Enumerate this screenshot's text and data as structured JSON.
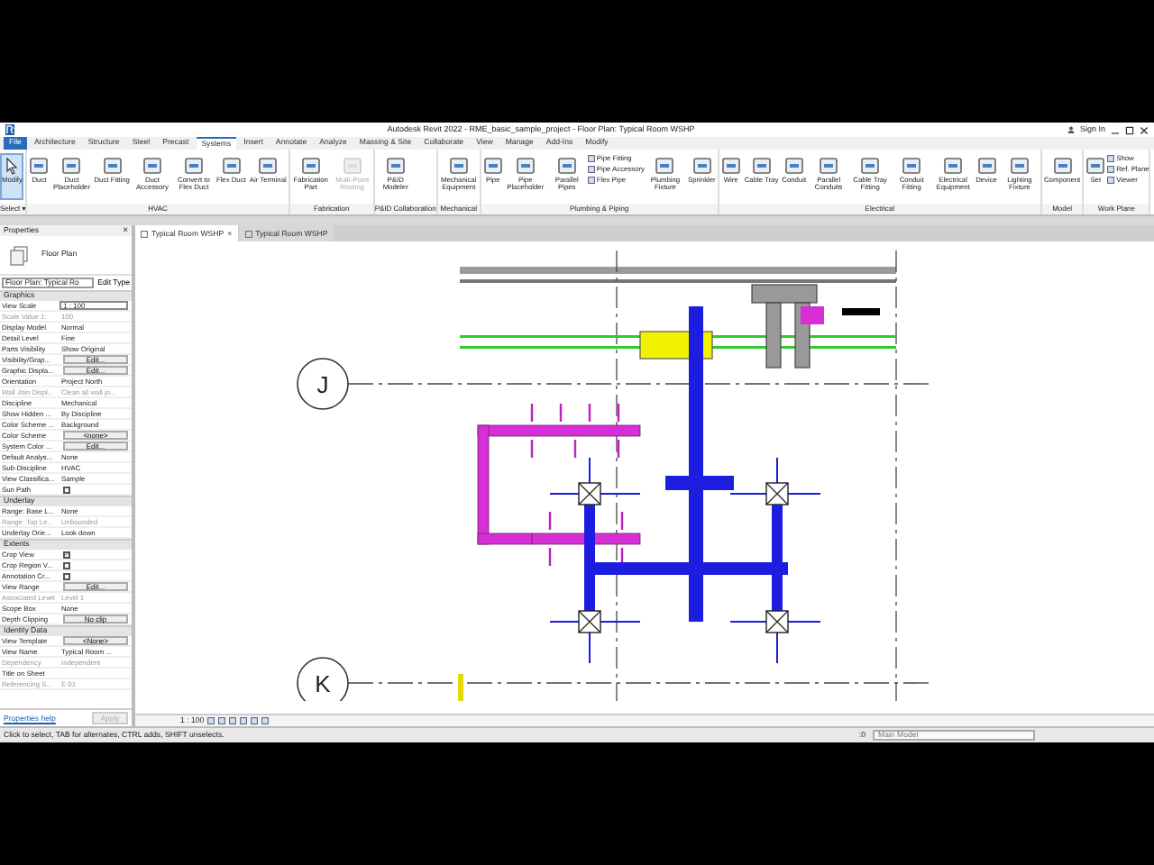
{
  "title_bar": {
    "title": "Autodesk Revit 2022 - RME_basic_sample_project - Floor Plan: Typical Room WSHP",
    "sign_in": "Sign In"
  },
  "menu_tabs": [
    {
      "label": "File",
      "selected": false
    },
    {
      "label": "Architecture",
      "selected": false
    },
    {
      "label": "Structure",
      "selected": false
    },
    {
      "label": "Steel",
      "selected": false
    },
    {
      "label": "Precast",
      "selected": false
    },
    {
      "label": "Systems",
      "selected": true
    },
    {
      "label": "Insert",
      "selected": false
    },
    {
      "label": "Annotate",
      "selected": false
    },
    {
      "label": "Analyze",
      "selected": false
    },
    {
      "label": "Massing & Site",
      "selected": false
    },
    {
      "label": "Collaborate",
      "selected": false
    },
    {
      "label": "View",
      "selected": false
    },
    {
      "label": "Manage",
      "selected": false
    },
    {
      "label": "Add-Ins",
      "selected": false
    },
    {
      "label": "Modify",
      "selected": false
    }
  ],
  "ribbon": {
    "modify_button": {
      "label": "Modify",
      "selected": true,
      "footer": "Select ▾"
    },
    "groups": [
      {
        "label": "HVAC",
        "tools": [
          {
            "kind": "large",
            "label": "Duct",
            "disabled": false
          },
          {
            "kind": "large",
            "label": "Duct Placeholder",
            "disabled": false
          },
          {
            "kind": "large",
            "label": "Duct Fitting",
            "disabled": false
          },
          {
            "kind": "large",
            "label": "Duct Accessory",
            "disabled": false
          },
          {
            "kind": "large",
            "label": "Convert to Flex Duct",
            "disabled": false
          },
          {
            "kind": "large",
            "label": "Flex Duct",
            "disabled": false
          },
          {
            "kind": "large",
            "label": "Air Terminal",
            "disabled": false
          }
        ]
      },
      {
        "label": "Fabrication",
        "tools": [
          {
            "kind": "large",
            "label": "Fabrication Part",
            "disabled": false
          },
          {
            "kind": "large",
            "label": "Multi-Point Routing",
            "disabled": true
          }
        ]
      },
      {
        "label": "P&ID Collaboration",
        "tools": [
          {
            "kind": "large",
            "label": "P&ID Modeler",
            "disabled": false
          }
        ]
      },
      {
        "label": "Mechanical",
        "tools": [
          {
            "kind": "large",
            "label": "Mechanical Equipment",
            "disabled": false
          }
        ]
      },
      {
        "label": "Plumbing & Piping",
        "tools": [
          {
            "kind": "large",
            "label": "Pipe",
            "disabled": false
          },
          {
            "kind": "large",
            "label": "Pipe Placeholder",
            "disabled": false
          },
          {
            "kind": "large",
            "label": "Parallel Pipes",
            "disabled": false
          },
          {
            "kind": "stack",
            "items": [
              {
                "label": "Pipe Fitting",
                "disabled": false
              },
              {
                "label": "Pipe Accessory",
                "disabled": false
              },
              {
                "label": "Flex Pipe",
                "disabled": false
              }
            ]
          },
          {
            "kind": "large",
            "label": "Plumbing Fixture",
            "disabled": false
          },
          {
            "kind": "large",
            "label": "Sprinkler",
            "disabled": false
          }
        ]
      },
      {
        "label": "Electrical",
        "tools": [
          {
            "kind": "large",
            "label": "Wire",
            "disabled": false
          },
          {
            "kind": "large",
            "label": "Cable Tray",
            "disabled": false
          },
          {
            "kind": "large",
            "label": "Conduit",
            "disabled": false
          },
          {
            "kind": "large",
            "label": "Parallel Conduits",
            "disabled": false
          },
          {
            "kind": "large",
            "label": "Cable Tray Fitting",
            "disabled": false
          },
          {
            "kind": "large",
            "label": "Conduit Fitting",
            "disabled": false
          },
          {
            "kind": "large",
            "label": "Electrical Equipment",
            "disabled": false
          },
          {
            "kind": "large",
            "label": "Device",
            "disabled": false
          },
          {
            "kind": "large",
            "label": "Lighting Fixture",
            "disabled": false
          }
        ]
      },
      {
        "label": "Model",
        "tools": [
          {
            "kind": "large",
            "label": "Component",
            "disabled": false
          }
        ]
      },
      {
        "label": "Work Plane",
        "tools": [
          {
            "kind": "large",
            "label": "Set",
            "disabled": false
          },
          {
            "kind": "stack",
            "items": [
              {
                "label": "Show",
                "disabled": false
              },
              {
                "label": "Ref. Plane",
                "disabled": false
              },
              {
                "label": "Viewer",
                "disabled": false
              }
            ]
          }
        ]
      }
    ]
  },
  "properties": {
    "title": "Properties",
    "close": "×",
    "type_name": "Floor Plan",
    "type_selector": "Floor Plan: Typical Ro",
    "edit_type": "Edit Type",
    "sections": [
      {
        "title": "Graphics",
        "rows": [
          {
            "kind": "field",
            "label": "View Scale",
            "value": "1 : 100",
            "disabled": false
          },
          {
            "kind": "text",
            "label": "Scale Value 1:",
            "value": "100",
            "disabled": true
          },
          {
            "kind": "text",
            "label": "Display Model",
            "value": "Normal",
            "disabled": false
          },
          {
            "kind": "text",
            "label": "Detail Level",
            "value": "Fine",
            "disabled": false
          },
          {
            "kind": "text",
            "label": "Parts Visibility",
            "value": "Show Original",
            "disabled": false
          },
          {
            "kind": "button",
            "label": "Visibility/Grap...",
            "value": "Edit...",
            "disabled": false
          },
          {
            "kind": "button",
            "label": "Graphic Displa...",
            "value": "Edit...",
            "disabled": false
          },
          {
            "kind": "text",
            "label": "Orientation",
            "value": "Project North",
            "disabled": false
          },
          {
            "kind": "text",
            "label": "Wall Join Displ...",
            "value": "Clean all wall jo...",
            "disabled": true
          },
          {
            "kind": "text",
            "label": "Discipline",
            "value": "Mechanical",
            "disabled": false
          },
          {
            "kind": "text",
            "label": "Show Hidden ...",
            "value": "By Discipline",
            "disabled": false
          },
          {
            "kind": "text",
            "label": "Color Scheme ...",
            "value": "Background",
            "disabled": false
          },
          {
            "kind": "button",
            "label": "Color Scheme",
            "value": "<none>",
            "disabled": false
          },
          {
            "kind": "button",
            "label": "System Color ...",
            "value": "Edit...",
            "disabled": false
          },
          {
            "kind": "text",
            "label": "Default Analys...",
            "value": "None",
            "disabled": false
          },
          {
            "kind": "text",
            "label": "Sub-Discipline",
            "value": "HVAC",
            "disabled": false
          },
          {
            "kind": "text",
            "label": "View Classifica...",
            "value": "Sample",
            "disabled": false
          },
          {
            "kind": "checkbox",
            "label": "Sun Path",
            "checked": false,
            "disabled": false
          }
        ]
      },
      {
        "title": "Underlay",
        "rows": [
          {
            "kind": "text",
            "label": "Range: Base L...",
            "value": "None",
            "disabled": false
          },
          {
            "kind": "text",
            "label": "Range: Top Le...",
            "value": "Unbounded",
            "disabled": true
          },
          {
            "kind": "text",
            "label": "Underlay Orie...",
            "value": "Look down",
            "disabled": false
          }
        ]
      },
      {
        "title": "Extents",
        "rows": [
          {
            "kind": "checkbox",
            "label": "Crop View",
            "checked": true,
            "disabled": false
          },
          {
            "kind": "checkbox",
            "label": "Crop Region V...",
            "checked": false,
            "disabled": false
          },
          {
            "kind": "checkbox",
            "label": "Annotation Cr...",
            "checked": false,
            "disabled": false
          },
          {
            "kind": "button",
            "label": "View Range",
            "value": "Edit...",
            "disabled": false
          },
          {
            "kind": "text",
            "label": "Associated Level",
            "value": "Level 1",
            "disabled": true
          },
          {
            "kind": "text",
            "label": "Scope Box",
            "value": "None",
            "disabled": false
          },
          {
            "kind": "button",
            "label": "Depth Clipping",
            "value": "No clip",
            "disabled": false
          }
        ]
      },
      {
        "title": "Identity Data",
        "rows": [
          {
            "kind": "button",
            "label": "View Template",
            "value": "<None>",
            "disabled": false
          },
          {
            "kind": "text",
            "label": "View Name",
            "value": "Typical Room ...",
            "disabled": false
          },
          {
            "kind": "text",
            "label": "Dependency",
            "value": "Independent",
            "disabled": true
          },
          {
            "kind": "text",
            "label": "Title on Sheet",
            "disabled": false
          },
          {
            "kind": "text",
            "label": "Referencing S...",
            "value": "E 01",
            "disabled": true
          }
        ]
      }
    ],
    "help_link": "Properties help",
    "apply": {
      "label": "Apply",
      "disabled": true
    }
  },
  "view_tabs": [
    {
      "label": "Typical Room WSHP",
      "selected": true,
      "close": "×"
    },
    {
      "label": "Typical Room WSHP",
      "selected": false
    }
  ],
  "grids": [
    {
      "label": "J"
    },
    {
      "label": "K"
    }
  ],
  "view_control": {
    "scale": "1 : 100"
  },
  "status_bar": {
    "message": "Click to select, TAB for alternates, CTRL adds, SHIFT unselects.",
    "count": ":0",
    "model": "Main Model"
  }
}
